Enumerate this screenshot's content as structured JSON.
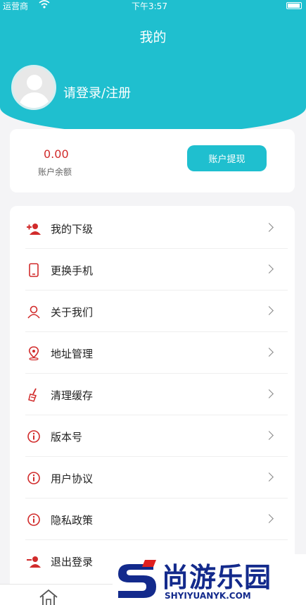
{
  "status_bar": {
    "carrier": "运营商",
    "time": "下午3:57"
  },
  "header": {
    "title": "我的",
    "login_text": "请登录/注册"
  },
  "balance": {
    "amount": "0.00",
    "label": "账户余额",
    "withdraw_label": "账户提现"
  },
  "menu": {
    "items": [
      {
        "label": "我的下级",
        "icon": "add-user-icon"
      },
      {
        "label": "更换手机",
        "icon": "phone-icon"
      },
      {
        "label": "关于我们",
        "icon": "person-icon"
      },
      {
        "label": "地址管理",
        "icon": "location-icon"
      },
      {
        "label": "清理缓存",
        "icon": "broom-icon"
      },
      {
        "label": "版本号",
        "icon": "info-icon"
      },
      {
        "label": "用户协议",
        "icon": "info-icon"
      },
      {
        "label": "隐私政策",
        "icon": "info-icon"
      },
      {
        "label": "退出登录",
        "icon": "remove-user-icon"
      }
    ]
  },
  "tab_bar": {
    "home_icon": "home-icon"
  },
  "watermark": {
    "text": "尚游乐园",
    "url": "SHYIYUANYK.COM"
  },
  "colors": {
    "accent": "#1fbfcf",
    "icon_red": "#d12b2b",
    "watermark_blue": "#132a8c"
  }
}
